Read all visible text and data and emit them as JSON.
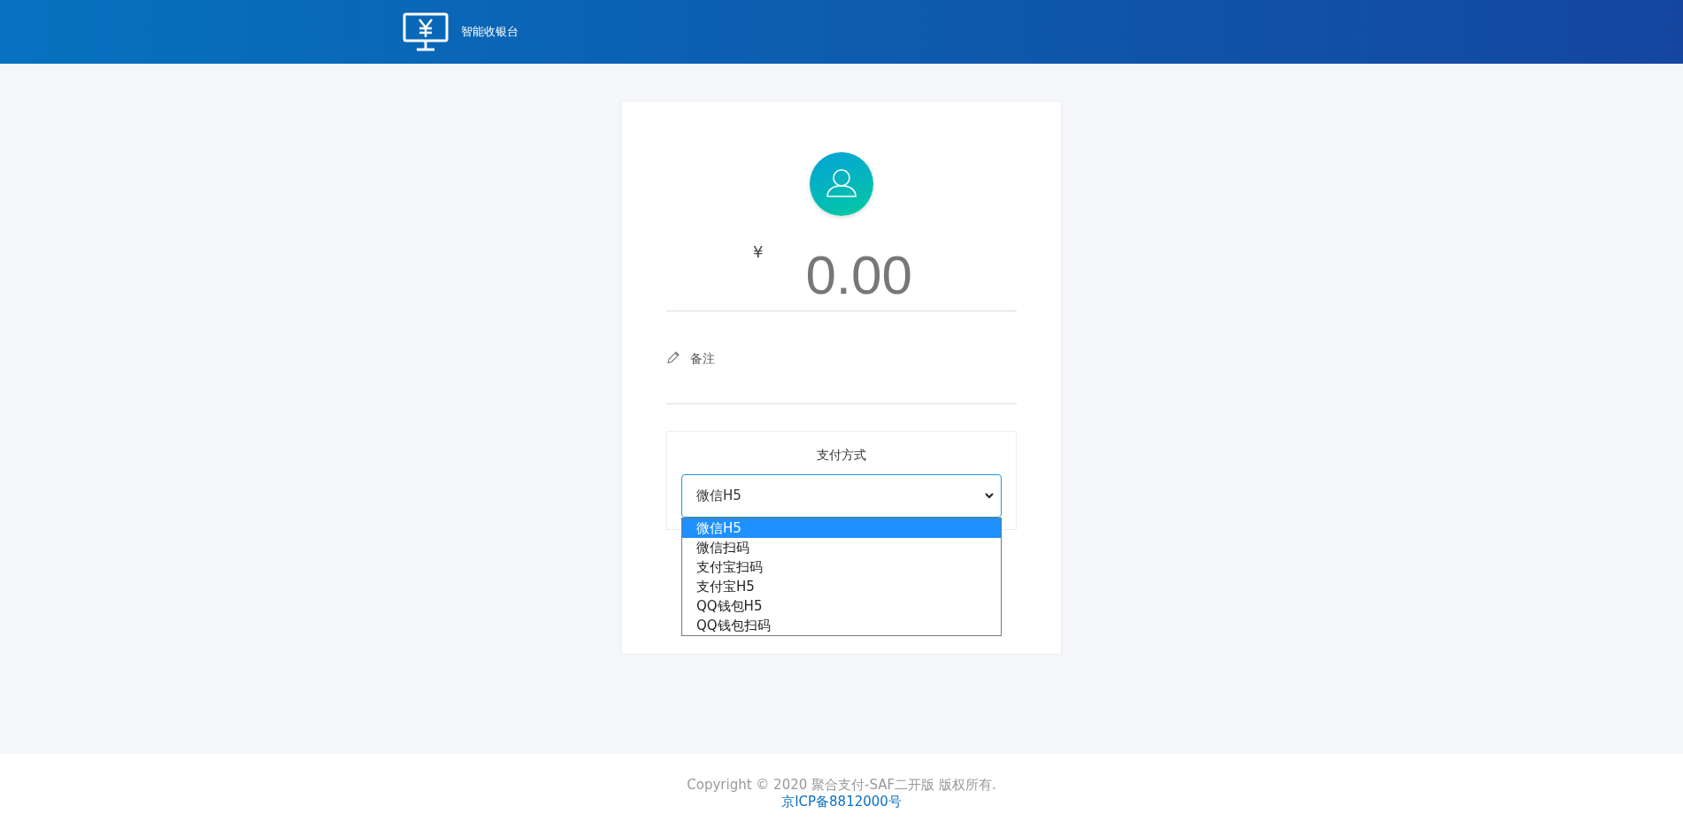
{
  "header": {
    "title": "智能收银台"
  },
  "amount": {
    "currency": "¥",
    "value": "0.00"
  },
  "remark": {
    "placeholder": "备注"
  },
  "payment": {
    "label": "支付方式",
    "value": "微信H5",
    "expanded": true,
    "options": [
      {
        "label": "微信H5",
        "selected": true
      },
      {
        "label": "微信扫码",
        "selected": false
      },
      {
        "label": "支付宝扫码",
        "selected": false
      },
      {
        "label": "支付宝H5",
        "selected": false
      },
      {
        "label": "QQ钱包H5",
        "selected": false
      },
      {
        "label": "QQ钱包扫码",
        "selected": false
      }
    ]
  },
  "footer": {
    "copyright": "Copyright © 2020 聚合支付-SAF二开版 版权所有.",
    "icp": "京ICP备8812000号"
  }
}
